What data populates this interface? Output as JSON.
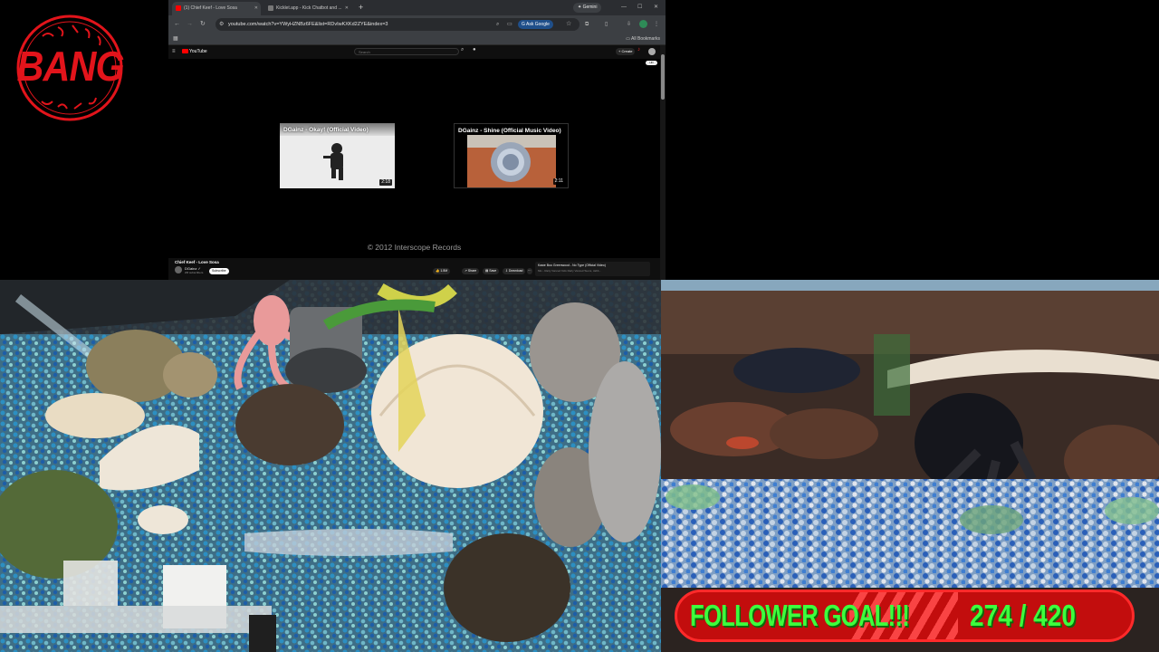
{
  "logo": {
    "text": "BANG",
    "color": "#e2141b"
  },
  "browser": {
    "tabs": [
      {
        "label": "(1) Chief Keef - Love Sosa",
        "active": true
      },
      {
        "label": "Kicklet.app - Kick Chatbot and ...",
        "active": false
      }
    ],
    "new_tab_icon": "plus-icon",
    "gemini_label": "Gemini",
    "window_controls": [
      "minimize-icon",
      "maximize-icon",
      "close-icon"
    ],
    "url": "youtube.com/watch?v=YWyHZNBz6FE&list=RDvIwKXKd2ZYE&index=3",
    "ask_google_label": "Ask Google",
    "all_bookmarks_label": "All Bookmarks"
  },
  "youtube": {
    "brand": "YouTube",
    "search_placeholder": "Search",
    "create_label": "+ Create",
    "quality_badge": "HD",
    "endcards": [
      {
        "title": "DGainz - Okay! (Official Video)",
        "duration": "2:18"
      },
      {
        "title": "DGainz - Shine (Official Music Video)",
        "duration": "2:11"
      }
    ],
    "copyright": "© 2012 Interscope Records",
    "video_title": "Chief Keef - Love Sosa",
    "channel_name": "DGainz ✓",
    "channel_subs": "2M subscribers",
    "subscribe_label": "Subscribe",
    "actions": [
      "1.5M",
      "Share",
      "Save",
      "Download",
      "···"
    ],
    "next_up_title": "Kawe Boo Greenwood - No Type (Official Video)",
    "next_up_meta": "Mix - Rarly Vanced Kids Rarly Vanced Teens, Jabb..."
  },
  "follower_goal": {
    "label": "FOLLOWER GOAL!!!",
    "current": 274,
    "target": 420,
    "display": "274 / 420",
    "text_color": "#3dff3d",
    "bar_color": "#c20d0d"
  }
}
